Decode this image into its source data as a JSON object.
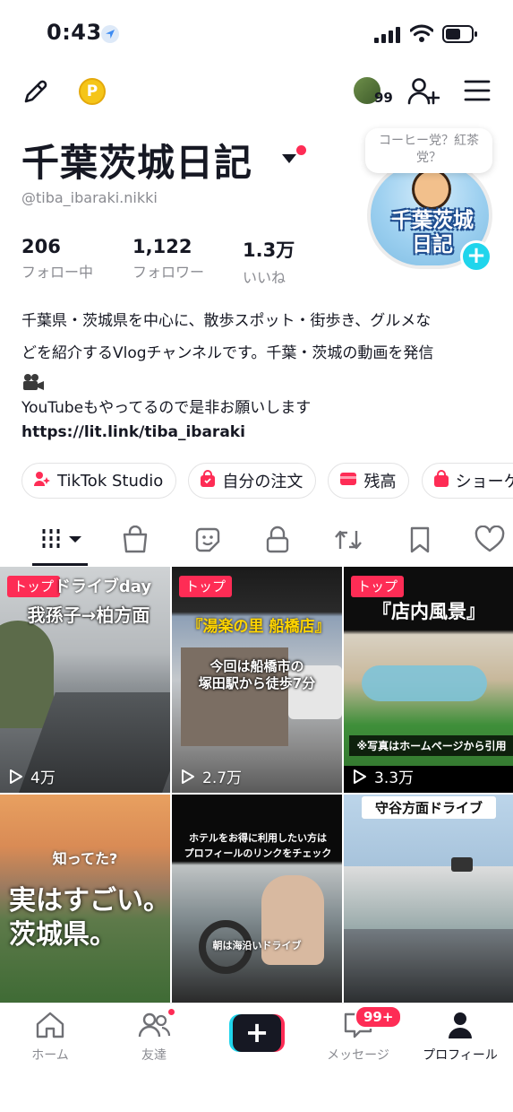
{
  "status_bar": {
    "time": "0:43"
  },
  "header": {
    "coin_label": "P",
    "visitor_count": "99"
  },
  "profile": {
    "display_name": "千葉茨城日記",
    "username": "@tiba_ibaraki.nikki",
    "stats": [
      {
        "value": "206",
        "label": "フォロー中"
      },
      {
        "value": "1,122",
        "label": "フォロワー"
      },
      {
        "value": "1.3万",
        "label": "いいね"
      }
    ],
    "avatar_text_line1": "千葉茨城",
    "avatar_text_line2": "日記",
    "bubble_text": "コーヒー党？紅茶党？",
    "bio_lines": [
      "千葉県・茨城県を中心に、散歩スポット・街歩き、グルメな",
      "どを紹介するVlogチャンネルです。千葉・茨城の動画を発信",
      "YouTubeもやってるので是非お願いします"
    ],
    "bio_link": "https://lit.link/tiba_ibaraki"
  },
  "chips": [
    {
      "label": "TikTok Studio",
      "icon": "tiktok-studio-icon"
    },
    {
      "label": "自分の注文",
      "icon": "shopping-bag-icon"
    },
    {
      "label": "残高",
      "icon": "wallet-icon"
    },
    {
      "label": "ショーケ",
      "icon": "showcase-icon"
    }
  ],
  "tabs": [
    "videos",
    "shop",
    "favorites",
    "private",
    "reposts",
    "saved",
    "liked"
  ],
  "videos": [
    {
      "pinned": "トップ",
      "views": "4万",
      "caption_top": "ドライブday",
      "caption_sub": "我孫子→柏方面"
    },
    {
      "pinned": "トップ",
      "views": "2.7万",
      "caption_top": "『湯楽の里 船橋店』",
      "caption_sub": "今回は船橋市の\n塚田駅から徒歩7分"
    },
    {
      "pinned": "トップ",
      "views": "3.3万",
      "caption_top": "『店内風景』",
      "caption_sub": "※写真はホームページから引用"
    },
    {
      "caption_top": "知ってた?",
      "caption_sub": "実はすごい。\n茨城県。"
    },
    {
      "caption_top": "ホテルをお得に利用したい方は\nプロフィールのリンクをチェック",
      "caption_sub": "朝は海沿いドライブ"
    },
    {
      "caption_top": "守谷方面ドライブ"
    }
  ],
  "bottom_nav": {
    "home": "ホーム",
    "friends": "友達",
    "messages": "メッセージ",
    "messages_badge": "99+",
    "profile": "プロフィール"
  },
  "colors": {
    "accent": "#fe2c55",
    "cyan": "#20d5ec",
    "text": "#161823",
    "muted": "#8a8b91"
  }
}
